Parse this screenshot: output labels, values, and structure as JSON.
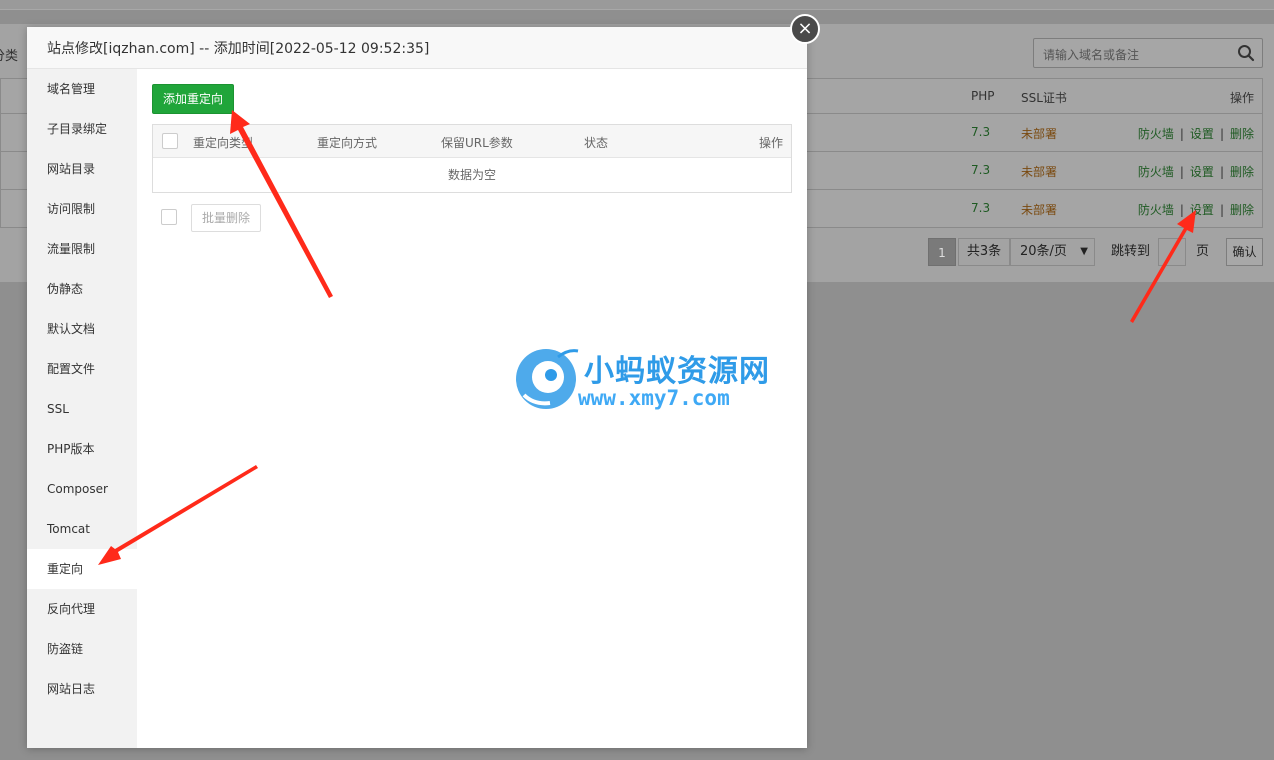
{
  "background": {
    "category_label": "分类",
    "search_placeholder": "请输入域名或备注",
    "table_headers": {
      "php": "PHP",
      "ssl": "SSL证书",
      "actions": "操作"
    },
    "rows": [
      {
        "php": "7.3",
        "ssl": "未部署",
        "firewall": "防火墙",
        "settings": "设置",
        "delete": "删除"
      },
      {
        "php": "7.3",
        "ssl": "未部署",
        "firewall": "防火墙",
        "settings": "设置",
        "delete": "删除"
      },
      {
        "php": "7.3",
        "ssl": "未部署",
        "firewall": "防火墙",
        "settings": "设置",
        "delete": "删除"
      }
    ],
    "separator": "|",
    "pager": {
      "current_page": "1",
      "total": "共3条",
      "per_page": "20条/页",
      "goto_label": "跳转到",
      "page_word": "页",
      "confirm": "确认"
    }
  },
  "modal": {
    "title": "站点修改[iqzhan.com] -- 添加时间[2022-05-12 09:52:35]",
    "close_symbol": "×",
    "menu": [
      "域名管理",
      "子目录绑定",
      "网站目录",
      "访问限制",
      "流量限制",
      "伪静态",
      "默认文档",
      "配置文件",
      "SSL",
      "PHP版本",
      "Composer",
      "Tomcat",
      "重定向",
      "反向代理",
      "防盗链",
      "网站日志"
    ],
    "active_menu": "重定向",
    "add_button": "添加重定向",
    "table": {
      "headers": [
        "重定向类型",
        "重定向方式",
        "保留URL参数",
        "状态",
        "操作"
      ],
      "empty_text": "数据为空"
    },
    "batch_delete": "批量删除"
  },
  "watermark": {
    "title": "小蚂蚁资源网",
    "url": "www.xmy7.com"
  },
  "colors": {
    "accent_green": "#20a53a",
    "arrow_red": "#ff2a1a",
    "watermark_blue": "#2f9be8"
  }
}
